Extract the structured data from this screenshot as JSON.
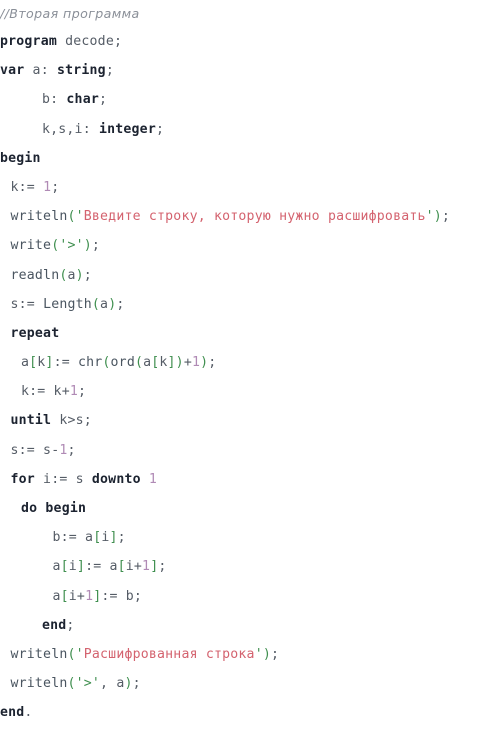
{
  "document": {
    "title": "Pascal source listing",
    "language": "Pascal",
    "background_color": "#ffffff",
    "palette": {
      "comment": "#8a8f98",
      "keyword": "#1c2330",
      "identifier": "#555c66",
      "punctuation": "#3f8f4f",
      "string": "#d4636f",
      "string_quote": "#3f8f4f",
      "number": "#b08ab5"
    }
  },
  "code": {
    "lines": [
      {
        "id": "line-1",
        "indent": 0,
        "tokens": [
          {
            "t": "comment",
            "v": "//Вторая программа"
          }
        ]
      },
      {
        "id": "line-2",
        "indent": 0,
        "tokens": [
          {
            "t": "kw",
            "v": "program"
          },
          {
            "t": "ident",
            "v": " decode"
          },
          {
            "t": "semi",
            "v": ";"
          }
        ]
      },
      {
        "id": "line-3",
        "indent": 0,
        "tokens": [
          {
            "t": "kw",
            "v": "var"
          },
          {
            "t": "ident",
            "v": " a: "
          },
          {
            "t": "type",
            "v": "string"
          },
          {
            "t": "semi",
            "v": ";"
          }
        ]
      },
      {
        "id": "line-4",
        "indent": 4,
        "tokens": [
          {
            "t": "ident",
            "v": "b: "
          },
          {
            "t": "type",
            "v": "char"
          },
          {
            "t": "semi",
            "v": ";"
          }
        ]
      },
      {
        "id": "line-5",
        "indent": 4,
        "tokens": [
          {
            "t": "ident",
            "v": "k,s,i: "
          },
          {
            "t": "type",
            "v": "integer"
          },
          {
            "t": "semi",
            "v": ";"
          }
        ]
      },
      {
        "id": "line-6",
        "indent": 0,
        "tokens": [
          {
            "t": "kw",
            "v": "begin"
          }
        ]
      },
      {
        "id": "line-7",
        "indent": 1,
        "tokens": [
          {
            "t": "ident",
            "v": "k:= "
          },
          {
            "t": "num",
            "v": "1"
          },
          {
            "t": "semi",
            "v": ";"
          }
        ]
      },
      {
        "id": "line-8",
        "indent": 1,
        "tokens": [
          {
            "t": "fn",
            "v": "writeln"
          },
          {
            "t": "punc",
            "v": "("
          },
          {
            "t": "strq",
            "v": "'"
          },
          {
            "t": "str",
            "v": "Введите строку, которую нужно расшифровать"
          },
          {
            "t": "strq",
            "v": "'"
          },
          {
            "t": "punc",
            "v": ")"
          },
          {
            "t": "semi",
            "v": ";"
          }
        ]
      },
      {
        "id": "line-9",
        "indent": 1,
        "tokens": [
          {
            "t": "fn",
            "v": "write"
          },
          {
            "t": "punc",
            "v": "("
          },
          {
            "t": "strq",
            "v": "'>'"
          },
          {
            "t": "punc",
            "v": ")"
          },
          {
            "t": "semi",
            "v": ";"
          }
        ]
      },
      {
        "id": "line-10",
        "indent": 1,
        "tokens": [
          {
            "t": "fn",
            "v": "readln"
          },
          {
            "t": "punc",
            "v": "("
          },
          {
            "t": "ident",
            "v": "a"
          },
          {
            "t": "punc",
            "v": ")"
          },
          {
            "t": "semi",
            "v": ";"
          }
        ]
      },
      {
        "id": "line-11",
        "indent": 1,
        "tokens": [
          {
            "t": "ident",
            "v": "s:= "
          },
          {
            "t": "fn",
            "v": "Length"
          },
          {
            "t": "punc",
            "v": "("
          },
          {
            "t": "ident",
            "v": "a"
          },
          {
            "t": "punc",
            "v": ")"
          },
          {
            "t": "semi",
            "v": ";"
          }
        ]
      },
      {
        "id": "line-12",
        "indent": 1,
        "tokens": [
          {
            "t": "kw",
            "v": "repeat"
          }
        ]
      },
      {
        "id": "line-13",
        "indent": 2,
        "tokens": [
          {
            "t": "ident",
            "v": "a"
          },
          {
            "t": "bracket",
            "v": "["
          },
          {
            "t": "ident",
            "v": "k"
          },
          {
            "t": "bracket",
            "v": "]"
          },
          {
            "t": "ident",
            "v": ":= "
          },
          {
            "t": "fn",
            "v": "chr"
          },
          {
            "t": "punc",
            "v": "("
          },
          {
            "t": "fn",
            "v": "ord"
          },
          {
            "t": "punc",
            "v": "("
          },
          {
            "t": "ident",
            "v": "a"
          },
          {
            "t": "bracket",
            "v": "["
          },
          {
            "t": "ident",
            "v": "k"
          },
          {
            "t": "bracket",
            "v": "]"
          },
          {
            "t": "punc",
            "v": ")"
          },
          {
            "t": "op",
            "v": "+"
          },
          {
            "t": "num",
            "v": "1"
          },
          {
            "t": "punc",
            "v": ")"
          },
          {
            "t": "semi",
            "v": ";"
          }
        ]
      },
      {
        "id": "line-14",
        "indent": 2,
        "tokens": [
          {
            "t": "ident",
            "v": "k:= k"
          },
          {
            "t": "op",
            "v": "+"
          },
          {
            "t": "num",
            "v": "1"
          },
          {
            "t": "semi",
            "v": ";"
          }
        ]
      },
      {
        "id": "line-15",
        "indent": 1,
        "tokens": [
          {
            "t": "kw",
            "v": "until"
          },
          {
            "t": "ident",
            "v": " k>s"
          },
          {
            "t": "semi",
            "v": ";"
          }
        ]
      },
      {
        "id": "line-16",
        "indent": 1,
        "tokens": [
          {
            "t": "ident",
            "v": "s:= s"
          },
          {
            "t": "op",
            "v": "-"
          },
          {
            "t": "num",
            "v": "1"
          },
          {
            "t": "semi",
            "v": ";"
          }
        ]
      },
      {
        "id": "line-17",
        "indent": 1,
        "tokens": [
          {
            "t": "kw",
            "v": "for"
          },
          {
            "t": "ident",
            "v": " i:= s "
          },
          {
            "t": "kw",
            "v": "downto"
          },
          {
            "t": "ident",
            "v": " "
          },
          {
            "t": "num",
            "v": "1"
          }
        ]
      },
      {
        "id": "line-18",
        "indent": 2,
        "tokens": [
          {
            "t": "kw",
            "v": "do"
          },
          {
            "t": "ident",
            "v": " "
          },
          {
            "t": "kw",
            "v": "begin"
          }
        ]
      },
      {
        "id": "line-19",
        "indent": 5,
        "tokens": [
          {
            "t": "ident",
            "v": "b:= a"
          },
          {
            "t": "bracket",
            "v": "["
          },
          {
            "t": "ident",
            "v": "i"
          },
          {
            "t": "bracket",
            "v": "]"
          },
          {
            "t": "semi",
            "v": ";"
          }
        ]
      },
      {
        "id": "line-20",
        "indent": 5,
        "tokens": [
          {
            "t": "ident",
            "v": "a"
          },
          {
            "t": "bracket",
            "v": "["
          },
          {
            "t": "ident",
            "v": "i"
          },
          {
            "t": "bracket",
            "v": "]"
          },
          {
            "t": "ident",
            "v": ":= a"
          },
          {
            "t": "bracket",
            "v": "["
          },
          {
            "t": "ident",
            "v": "i"
          },
          {
            "t": "op",
            "v": "+"
          },
          {
            "t": "num",
            "v": "1"
          },
          {
            "t": "bracket",
            "v": "]"
          },
          {
            "t": "semi",
            "v": ";"
          }
        ]
      },
      {
        "id": "line-21",
        "indent": 5,
        "tokens": [
          {
            "t": "ident",
            "v": "a"
          },
          {
            "t": "bracket",
            "v": "["
          },
          {
            "t": "ident",
            "v": "i"
          },
          {
            "t": "op",
            "v": "+"
          },
          {
            "t": "num",
            "v": "1"
          },
          {
            "t": "bracket",
            "v": "]"
          },
          {
            "t": "ident",
            "v": ":= b"
          },
          {
            "t": "semi",
            "v": ";"
          }
        ]
      },
      {
        "id": "line-22",
        "indent": 4,
        "tokens": [
          {
            "t": "kw",
            "v": "end"
          },
          {
            "t": "semi",
            "v": ";"
          }
        ]
      },
      {
        "id": "line-23",
        "indent": 1,
        "tokens": [
          {
            "t": "fn",
            "v": "writeln"
          },
          {
            "t": "punc",
            "v": "("
          },
          {
            "t": "strq",
            "v": "'"
          },
          {
            "t": "str",
            "v": "Расшифрованная строка"
          },
          {
            "t": "strq",
            "v": "'"
          },
          {
            "t": "punc",
            "v": ")"
          },
          {
            "t": "semi",
            "v": ";"
          }
        ]
      },
      {
        "id": "line-24",
        "indent": 1,
        "tokens": [
          {
            "t": "fn",
            "v": "writeln"
          },
          {
            "t": "punc",
            "v": "("
          },
          {
            "t": "strq",
            "v": "'>'"
          },
          {
            "t": "ident",
            "v": ", a"
          },
          {
            "t": "punc",
            "v": ")"
          },
          {
            "t": "semi",
            "v": ";"
          }
        ]
      },
      {
        "id": "line-25",
        "indent": 0,
        "tokens": [
          {
            "t": "kw",
            "v": "end"
          },
          {
            "t": "semi",
            "v": "."
          }
        ]
      }
    ]
  }
}
